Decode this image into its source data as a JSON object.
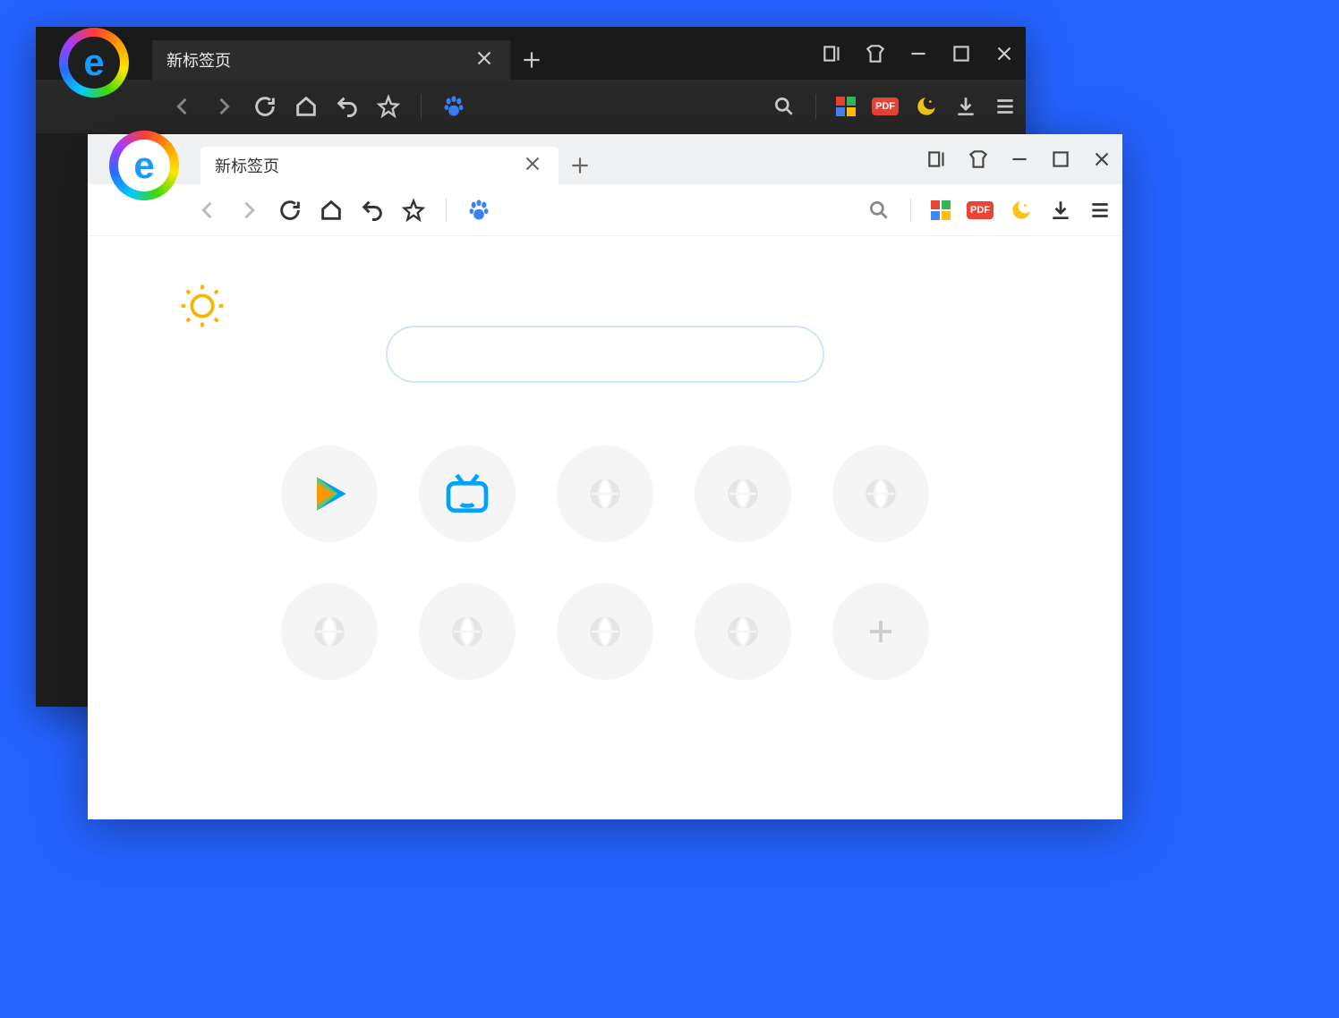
{
  "dark": {
    "tab_title": "新标签页",
    "pdf_label": "PDF"
  },
  "light": {
    "tab_title": "新标签页",
    "pdf_label": "PDF",
    "tiles": [
      "tencent-video",
      "bilibili",
      "empty",
      "empty",
      "empty",
      "empty",
      "empty",
      "empty",
      "empty",
      "add"
    ]
  }
}
